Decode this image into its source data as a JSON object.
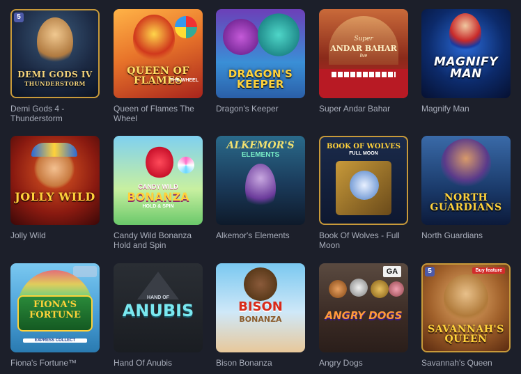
{
  "games": [
    {
      "title": "Demi Gods 4 - Thunderstorm",
      "art": "DEMI GODS IV",
      "art_sub": "THUNDERSTORM",
      "badge": "5"
    },
    {
      "title": "Queen of Flames The Wheel",
      "art": "QUEEN OF FLAMES",
      "art_sub": "THE WHEEL"
    },
    {
      "title": "Dragon's Keeper",
      "art": "DRAGON'S KEEPER"
    },
    {
      "title": "Super Andar Bahar",
      "art": "ANDAR BAHAR",
      "art_sub": "Super",
      "art_sub2": "live"
    },
    {
      "title": "Magnify Man",
      "art": "MAGNIFY MAN"
    },
    {
      "title": "Jolly Wild",
      "art": "JOLLY WILD"
    },
    {
      "title": "Candy Wild Bonanza Hold and Spin",
      "art": "BONANZA",
      "art_sub": "CANDY WILD",
      "art_sub2": "HOLD & SPIN"
    },
    {
      "title": "Alkemor's Elements",
      "art": "ALKEMOR'S",
      "art_sub": "ELEMENTS"
    },
    {
      "title": "Book Of Wolves - Full Moon",
      "art": "BOOK OF WOLVES",
      "art_sub": "FULL MOON"
    },
    {
      "title": "North Guardians",
      "art": "NORTH GUARDIANS"
    },
    {
      "title": "Fiona's Fortune™",
      "art": "FIONA'S FORTUNE",
      "art_sub": "EXPRESS COLLECT"
    },
    {
      "title": "Hand Of Anubis",
      "art": "ANUBIS",
      "art_sub": "HAND OF"
    },
    {
      "title": "Bison Bonanza",
      "art": "BISON",
      "art_sub": "BONANZA"
    },
    {
      "title": "Angry Dogs",
      "art": "ANGRY DOGS",
      "badge": "GA"
    },
    {
      "title": "Savannah's Queen",
      "art": "SAVANNAH'S QUEEN",
      "badge": "5",
      "badge2": "Buy feature"
    }
  ],
  "colors": {
    "background": "#1c1f2a",
    "title_text": "#a9aebb"
  }
}
